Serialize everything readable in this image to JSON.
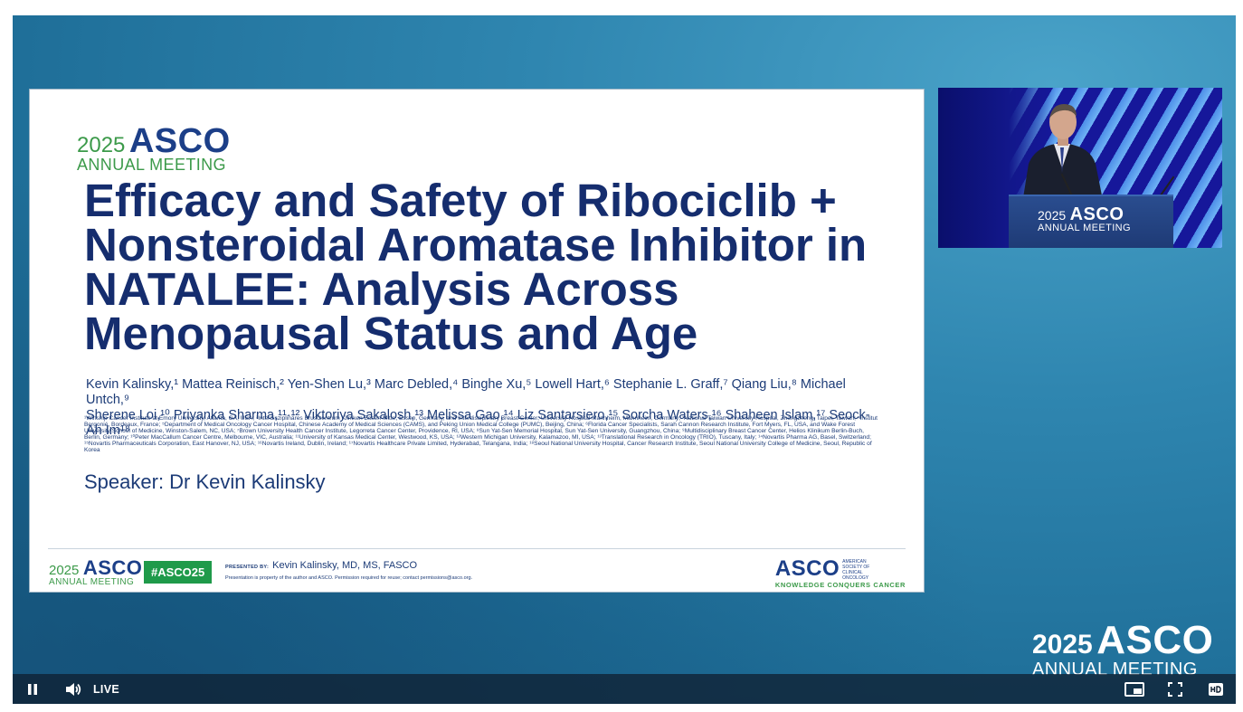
{
  "slide": {
    "brand": {
      "year": "2025",
      "name": "ASCO",
      "sub": "ANNUAL MEETING"
    },
    "title": "Efficacy and Safety of Ribociclib + Nonsteroidal Aromatase Inhibitor in NATALEE: Analysis Across Menopausal Status and Age",
    "authors_line1": "Kevin Kalinsky,¹ Mattea Reinisch,² Yen-Shen Lu,³ Marc Debled,⁴ Binghe Xu,⁵ Lowell Hart,⁶ Stephanie L. Graff,⁷ Qiang Liu,⁸ Michael Untch,⁹",
    "authors_line2": "Sherene Loi,¹⁰ Priyanka Sharma,¹¹·¹² Viktoriya Sakalosh,¹³ Melissa Gao,¹⁴ Liz Santarsiero,¹⁵ Sorcha Waters,¹⁶ Shaheen Islam,¹⁷ Seock-Ah Im¹⁸",
    "affiliations": "¹Winship Cancer Institute at Emory University, Atlanta, GA, USA; ²Interdisziplinäres Brustzentrum Kliniken Essen-Mitte, Essen, Germany, and Interdisciplinary Breast Center, University Hospital Mannheim, Mannheim, Germany; ³National Taiwan University Hospital, Zhongzheng, Taipei, Taiwan; ⁴Institut Bergonié, Bordeaux, France; ⁵Department of Medical Oncology Cancer Hospital, Chinese Academy of Medical Sciences (CAMS), and Peking Union Medical College (PUMC), Beijing, China; ⁶Florida Cancer Specialists, Sarah Cannon Research Institute, Fort Myers, FL, USA, and Wake Forest University School of Medicine, Winston-Salem, NC, USA; ⁷Brown University Health Cancer Institute, Legorreta Cancer Center, Providence, RI, USA; ⁸Sun Yat-Sen Memorial Hospital, Sun Yat-Sen University, Guangzhou, China; ⁹Multidisciplinary Breast Cancer Center, Helios Klinikum Berlin-Buch, Berlin, Germany; ¹⁰Peter MacCallum Cancer Centre, Melbourne, VIC, Australia; ¹¹University of Kansas Medical Center, Westwood, KS, USA; ¹²Western Michigan University, Kalamazoo, MI, USA; ¹³Translational Research in Oncology (TRIO), Tuscany, Italy; ¹⁴Novartis Pharma AG, Basel, Switzerland; ¹⁵Novartis Pharmaceuticals Corporation, East Hanover, NJ, USA; ¹⁶Novartis Ireland, Dublin, Ireland; ¹⁷Novartis Healthcare Private Limited, Hyderabad, Telangana, India; ¹⁸Seoul National University Hospital, Cancer Research Institute, Seoul National University College of Medicine, Seoul, Republic of Korea",
    "speaker": "Speaker: Dr Kevin Kalinsky",
    "footer": {
      "hashtag": "#ASCO25",
      "presented_by_label": "PRESENTED BY:",
      "presenter": "Kevin Kalinsky, MD, MS, FASCO",
      "fineprint": "Presentation is property of the author and ASCO. Permission required for reuse; contact permissions@asco.org.",
      "asco_word": "ASCO",
      "asco_side": "AMERICAN SOCIETY OF CLINICAL ONCOLOGY",
      "asco_tagline": "KNOWLEDGE CONQUERS CANCER"
    }
  },
  "camera": {
    "podium_brand": {
      "year": "2025",
      "name": "ASCO",
      "sub": "ANNUAL MEETING"
    }
  },
  "watermark": {
    "year": "2025",
    "name": "ASCO",
    "sub": "ANNUAL MEETING"
  },
  "controls": {
    "live_label": "LIVE",
    "icons": [
      "pause-icon",
      "volume-icon",
      "picture-in-picture-icon",
      "fullscreen-icon",
      "hd-icon"
    ]
  }
}
